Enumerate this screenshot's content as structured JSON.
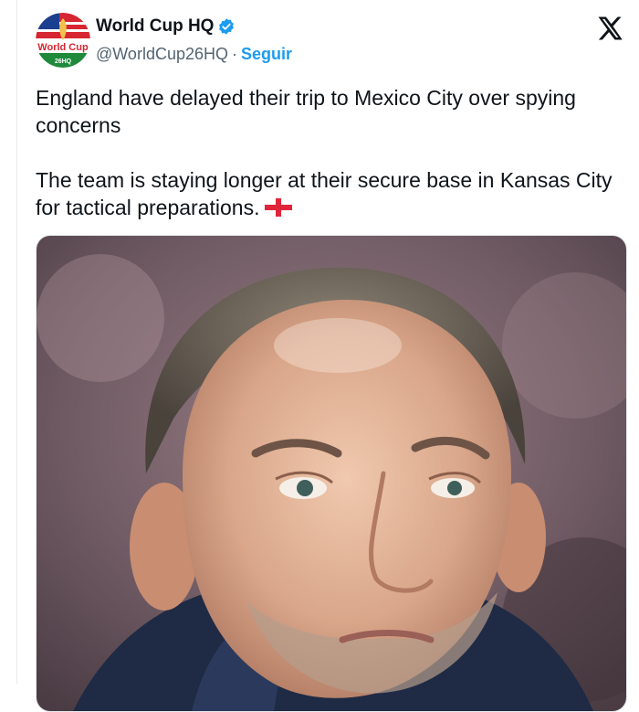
{
  "account": {
    "display_name": "World Cup HQ",
    "handle": "@WorldCup26HQ",
    "separator": "·",
    "follow_label": "Seguir",
    "avatar_text_main": "World Cup",
    "avatar_text_sub": "26HQ"
  },
  "tweet": {
    "paragraph_1": "England have delayed their trip to Mexico City over spying concerns",
    "paragraph_2": "The team is staying longer at their secure base in Kansas City for tactical preparations."
  },
  "icons": {
    "verified": "verified-badge-icon",
    "platform": "x-logo-icon",
    "flag": "england-flag-icon"
  },
  "colors": {
    "link_blue": "#1d9bf0",
    "text": "#0f1419",
    "muted": "#536471"
  }
}
